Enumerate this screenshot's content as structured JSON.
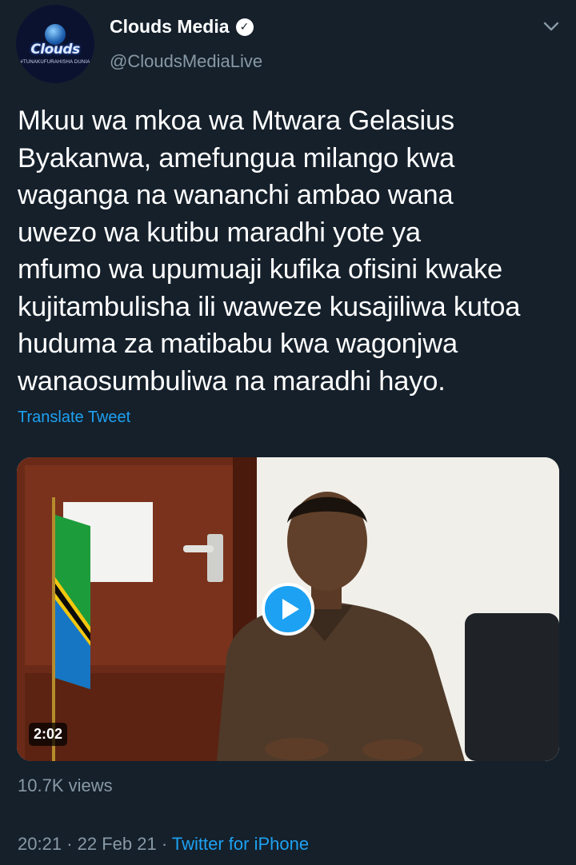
{
  "author": {
    "display_name": "Clouds Media",
    "handle": "@CloudsMediaLive",
    "avatar_logo_text": "Clouds",
    "avatar_tagline": "#TUNAKUFURAHISHA DUNIA"
  },
  "tweet": {
    "lines": [
      "Mkuu wa mkoa wa Mtwara Gelasius",
      "Byakanwa, amefungua milango kwa",
      "waganga na wananchi ambao wana",
      "uwezo wa kutibu maradhi yote ya",
      "mfumo wa upumuaji kufika ofisini kwake",
      "kujitambulisha ili waweze kusajiliwa kutoa",
      "huduma za matibabu kwa wagonjwa",
      "wanaosumbuliwa na maradhi hayo."
    ],
    "translate_label": "Translate Tweet"
  },
  "video": {
    "duration": "2:02",
    "views": "10.7K views"
  },
  "meta": {
    "time": "20:21",
    "date": "22 Feb 21",
    "separator": "·",
    "source": "Twitter for iPhone"
  },
  "colors": {
    "background": "#15202b",
    "accent": "#1da1f2",
    "secondary_text": "#8899a6"
  },
  "icons": [
    "verified-badge-icon",
    "chevron-down-icon",
    "play-icon"
  ]
}
